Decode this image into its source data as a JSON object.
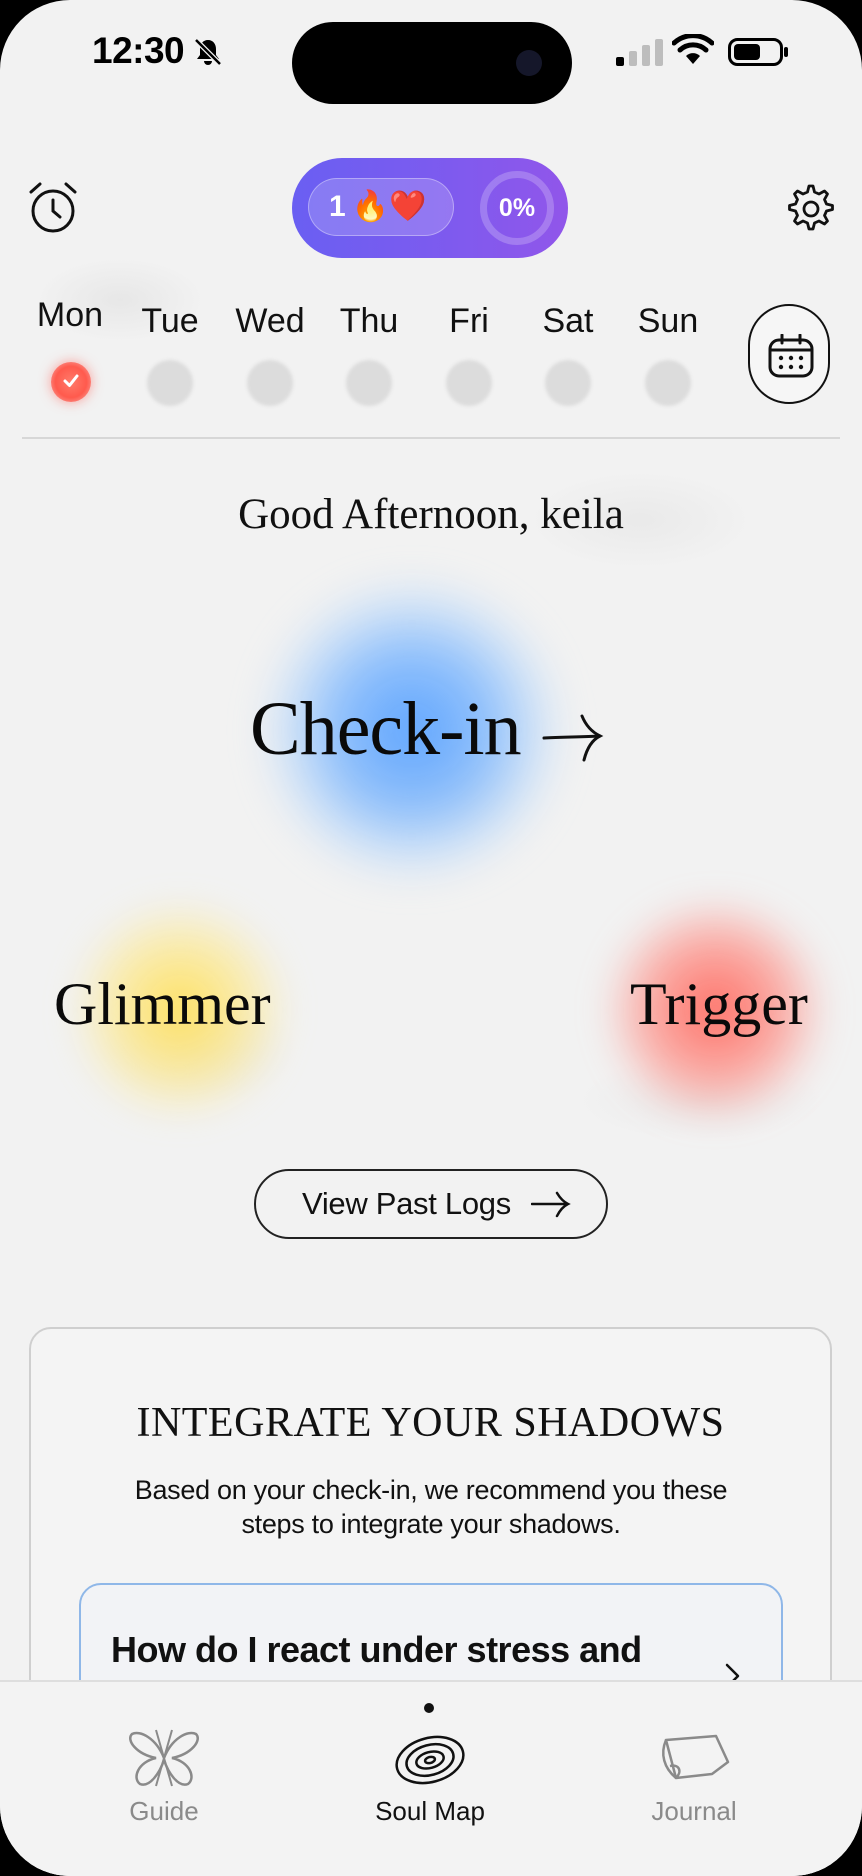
{
  "status_bar": {
    "time": "12:30",
    "icons": [
      "bell-slash-icon",
      "cellular-signal-icon",
      "wifi-icon",
      "battery-icon"
    ]
  },
  "header": {
    "alarm_icon": "alarm-clock-icon",
    "streak_count": "1",
    "streak_emoji": "🔥❤️",
    "progress_text": "0%",
    "settings_icon": "gear-icon"
  },
  "week": {
    "days": [
      {
        "label": "Mon",
        "done": true
      },
      {
        "label": "Tue",
        "done": false
      },
      {
        "label": "Wed",
        "done": false
      },
      {
        "label": "Thu",
        "done": false
      },
      {
        "label": "Fri",
        "done": false
      },
      {
        "label": "Sat",
        "done": false
      },
      {
        "label": "Sun",
        "done": false
      }
    ],
    "calendar_icon": "calendar-icon"
  },
  "main": {
    "greeting": "Good Afternoon, keila",
    "checkin_label": "Check-in",
    "glimmer_label": "Glimmer",
    "trigger_label": "Trigger",
    "past_logs_label": "View Past Logs"
  },
  "card": {
    "title": "INTEGRATE YOUR SHADOWS",
    "description": "Based on your check-in, we recommend you these steps to integrate your shadows.",
    "step_text": "How do I react under stress and"
  },
  "colors": {
    "streak_gradient_start": "#6a5ff2",
    "streak_gradient_end": "#9156ea",
    "checkin_blob": "#56a0ff",
    "glimmer_blob": "#ffde50",
    "trigger_blob": "#ff695f",
    "done_dot": "#ff5a4d"
  },
  "tabbar": {
    "tabs": [
      {
        "label": "Guide",
        "icon": "butterfly-icon",
        "active": false
      },
      {
        "label": "Soul Map",
        "icon": "spiral-icon",
        "active": true
      },
      {
        "label": "Journal",
        "icon": "journal-icon",
        "active": false
      }
    ]
  }
}
